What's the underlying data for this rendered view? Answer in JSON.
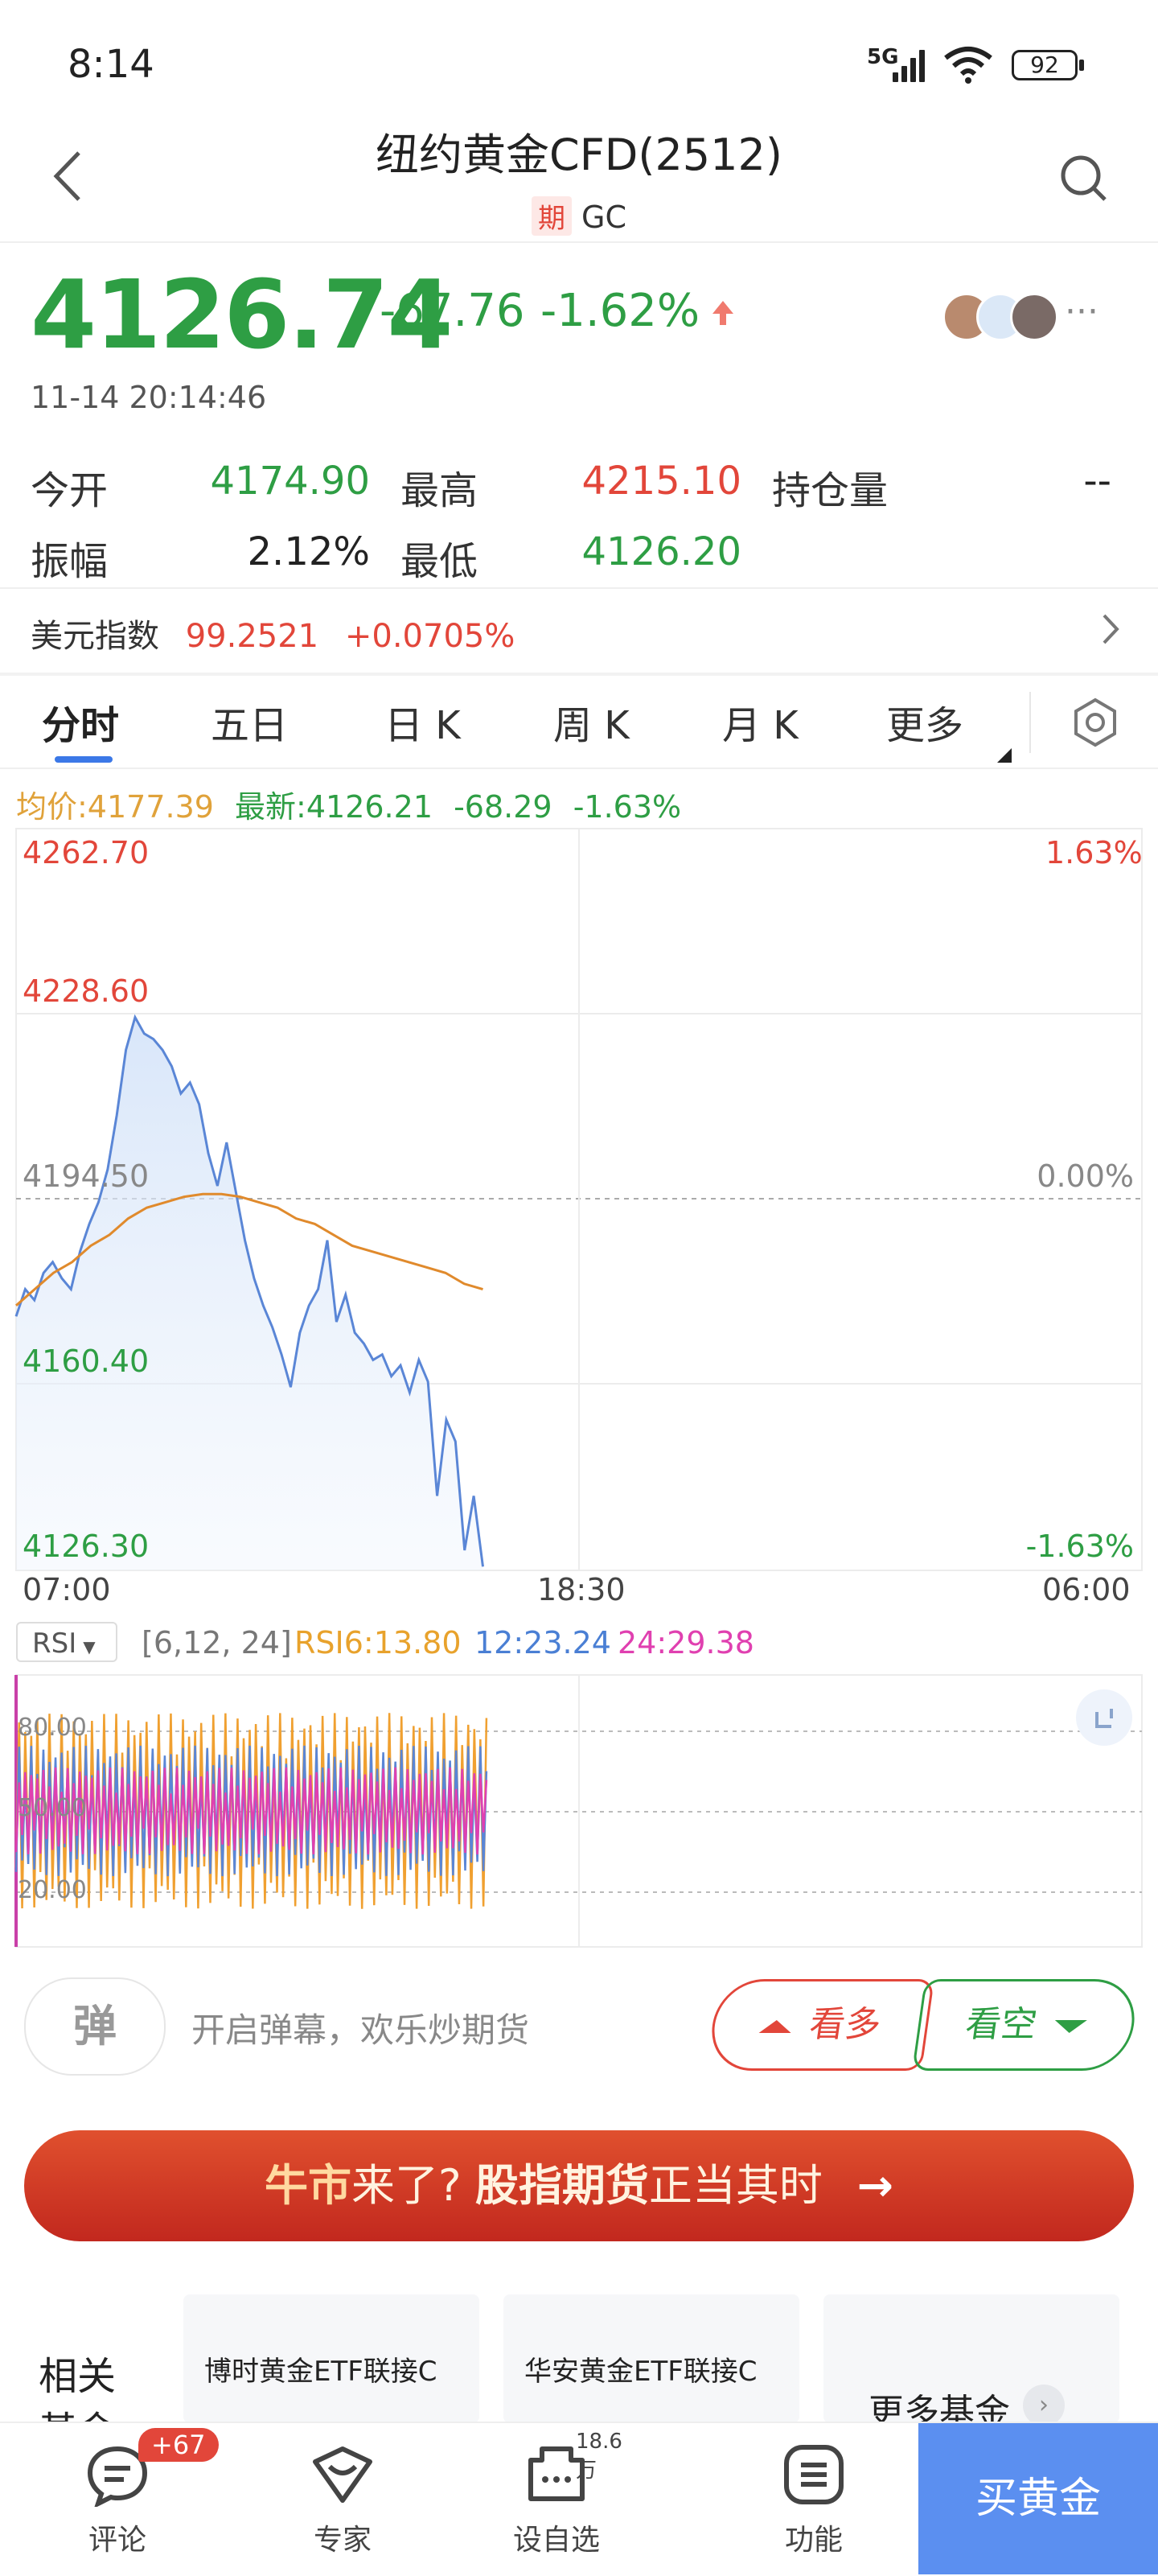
{
  "status": {
    "time": "8:14",
    "network": "5G",
    "battery": "92"
  },
  "header": {
    "title": "纽约黄金CFD(2512)",
    "tag": "期",
    "code": "GC"
  },
  "quote": {
    "price": "4126.74",
    "change": "-67.76",
    "change_pct": "-1.62%",
    "timestamp": "11-14 20:14:46",
    "stats": [
      {
        "label": "今开",
        "value": "4174.90",
        "color": "green"
      },
      {
        "label": "最高",
        "value": "4215.10",
        "color": "red"
      },
      {
        "label": "持仓量",
        "value": "--",
        "color": "dark"
      },
      {
        "label": "振幅",
        "value": "2.12%",
        "color": "dark"
      },
      {
        "label": "最低",
        "value": "4126.20",
        "color": "green"
      }
    ]
  },
  "index": {
    "label": "美元指数",
    "value": "99.2521",
    "change": "+0.0705%"
  },
  "tabs": [
    "分时",
    "五日",
    "日 K",
    "周 K",
    "月 K",
    "更多"
  ],
  "chart_data": {
    "type": "line",
    "legend": {
      "avg": "均价:4177.39",
      "latest": "最新:4126.21",
      "chg": "-68.29",
      "pct": "-1.63%"
    },
    "y_ticks": [
      "4262.70",
      "4228.60",
      "4194.50",
      "4160.40",
      "4126.30"
    ],
    "y_right_ticks": [
      "1.63%",
      "0.00%",
      "-1.63%"
    ],
    "x_ticks": [
      "07:00",
      "18:30",
      "06:00"
    ],
    "ylim": [
      4126.3,
      4262.7
    ],
    "price_series": [
      4173,
      4178,
      4176,
      4181,
      4183,
      4180,
      4178,
      4185,
      4190,
      4194,
      4200,
      4210,
      4222,
      4228,
      4225,
      4224,
      4222,
      4219,
      4214,
      4216,
      4212,
      4203,
      4197,
      4205,
      4196,
      4187,
      4180,
      4175,
      4171,
      4166,
      4160,
      4170,
      4175,
      4178,
      4187,
      4172,
      4177,
      4170,
      4168,
      4165,
      4166,
      4162,
      4164,
      4159,
      4165,
      4161,
      4140,
      4154,
      4150,
      4130,
      4140,
      4127
    ],
    "avg_series": [
      4175,
      4178,
      4181,
      4183,
      4186,
      4188,
      4191,
      4193,
      4194,
      4195,
      4195.5,
      4195.5,
      4195,
      4194,
      4193,
      4191,
      4190,
      4188,
      4186,
      4185,
      4184,
      4183,
      4182,
      4181,
      4179,
      4178
    ],
    "rsi": {
      "label": "RSI",
      "params": "[6,12, 24]",
      "rsi6": "RSI6:13.80",
      "rsi12": "12:23.24",
      "rsi24": "24:29.38",
      "ticks": [
        "80.00",
        "50.00",
        "20.00"
      ]
    }
  },
  "actions": {
    "danmaku_icon": "弹",
    "danmaku_placeholder": "开启弹幕，欢乐炒期货",
    "bull": "看多",
    "bear": "看空"
  },
  "banner": {
    "part1": "牛市",
    "part2": "来了? ",
    "part3": "股指期货",
    "part4": "正当其时"
  },
  "funds": {
    "section": "相关基金",
    "items": [
      "博时黄金ETF联接C",
      "华安黄金ETF联接C"
    ],
    "more": "更多基金"
  },
  "bottom_nav": [
    {
      "label": "评论",
      "badge": "+67"
    },
    {
      "label": "专家"
    },
    {
      "label": "设自选",
      "badge": "18.6万"
    },
    {
      "label": "功能"
    }
  ],
  "buy_button": "买黄金",
  "colors": {
    "up": "#e2463a",
    "down": "#2e9e44",
    "price_line": "#5a86d6",
    "avg_line": "#e08a2c",
    "rsi6": "#f0a030",
    "rsi12": "#5a86d6",
    "rsi24": "#e040b0"
  }
}
